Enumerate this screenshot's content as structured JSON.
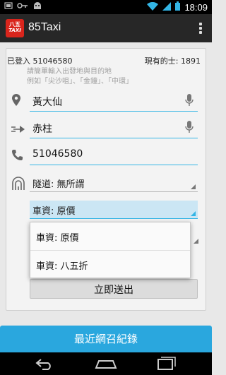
{
  "status_bar": {
    "time": "18:09",
    "left_icons": [
      "notification-icon",
      "key-icon",
      "android-icon"
    ],
    "right_icons": [
      "wifi-icon",
      "signal-icon",
      "battery-icon"
    ]
  },
  "action_bar": {
    "logo_text_top": "八五",
    "logo_text_bottom": "TAXI",
    "title": "85Taxi"
  },
  "form": {
    "login_status": "已登入 51046580",
    "online_taxis": "現有的士: 1891",
    "hint_line1": "請簡單輸入出發地與目的地",
    "hint_line2": "例如「尖沙咀」、「金鐘」、「中環」",
    "origin": "黃大仙",
    "destination": "赤柱",
    "phone": "51046580",
    "tunnel": "隧道: 無所謂",
    "fare": "車資: 原價",
    "submit_label": "立即送出"
  },
  "fare_dropdown": {
    "options": [
      "車資: 原價",
      "車資: 八五折"
    ]
  },
  "history_button": "最近網召紀錄",
  "colors": {
    "accent": "#33b5e5",
    "history_bg": "#2aa7de",
    "logo_red": "#d9251c"
  }
}
